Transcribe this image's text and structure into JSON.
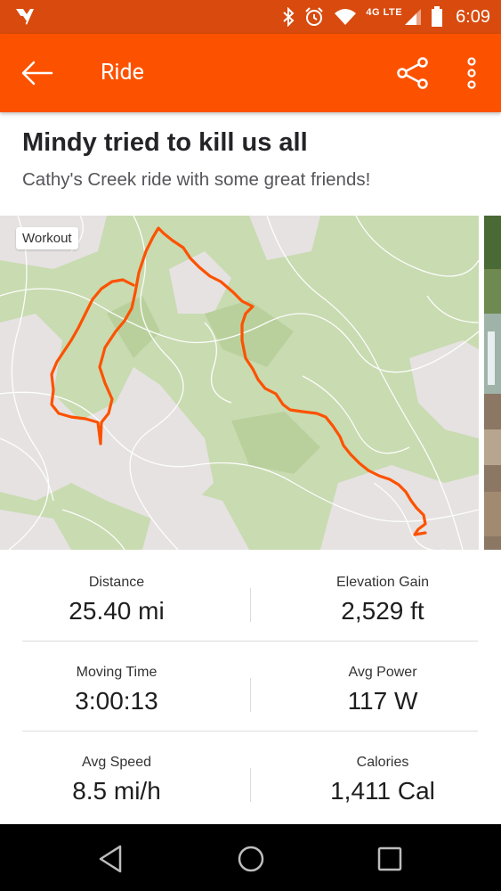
{
  "status_bar": {
    "network": "4G LTE",
    "time": "6:09",
    "icons": [
      "strava-logo-icon",
      "bluetooth-icon",
      "alarm-icon",
      "wifi-icon",
      "signal-icon",
      "battery-icon"
    ]
  },
  "app_bar": {
    "title": "Ride",
    "back_icon": "arrow-back-icon",
    "share_icon": "share-icon",
    "more_icon": "more-vert-icon"
  },
  "activity": {
    "title": "Mindy tried to kill us all",
    "description": "Cathy's Creek ride with some great friends!"
  },
  "map": {
    "badge": "Workout",
    "route_color": "#fc5200"
  },
  "stats": [
    {
      "left": {
        "label": "Distance",
        "value": "25.40 mi"
      },
      "right": {
        "label": "Elevation Gain",
        "value": "2,529 ft"
      }
    },
    {
      "left": {
        "label": "Moving Time",
        "value": "3:00:13"
      },
      "right": {
        "label": "Avg Power",
        "value": "117 W"
      }
    },
    {
      "left": {
        "label": "Avg Speed",
        "value": "8.5 mi/h"
      },
      "right": {
        "label": "Calories",
        "value": "1,411 Cal"
      }
    }
  ],
  "nav_bar": {
    "back": "nav-back-icon",
    "home": "nav-home-icon",
    "recents": "nav-recents-icon"
  },
  "colors": {
    "brand": "#fc5200",
    "status_bar": "#d84a0e",
    "map_green": "#c9dbb1"
  }
}
